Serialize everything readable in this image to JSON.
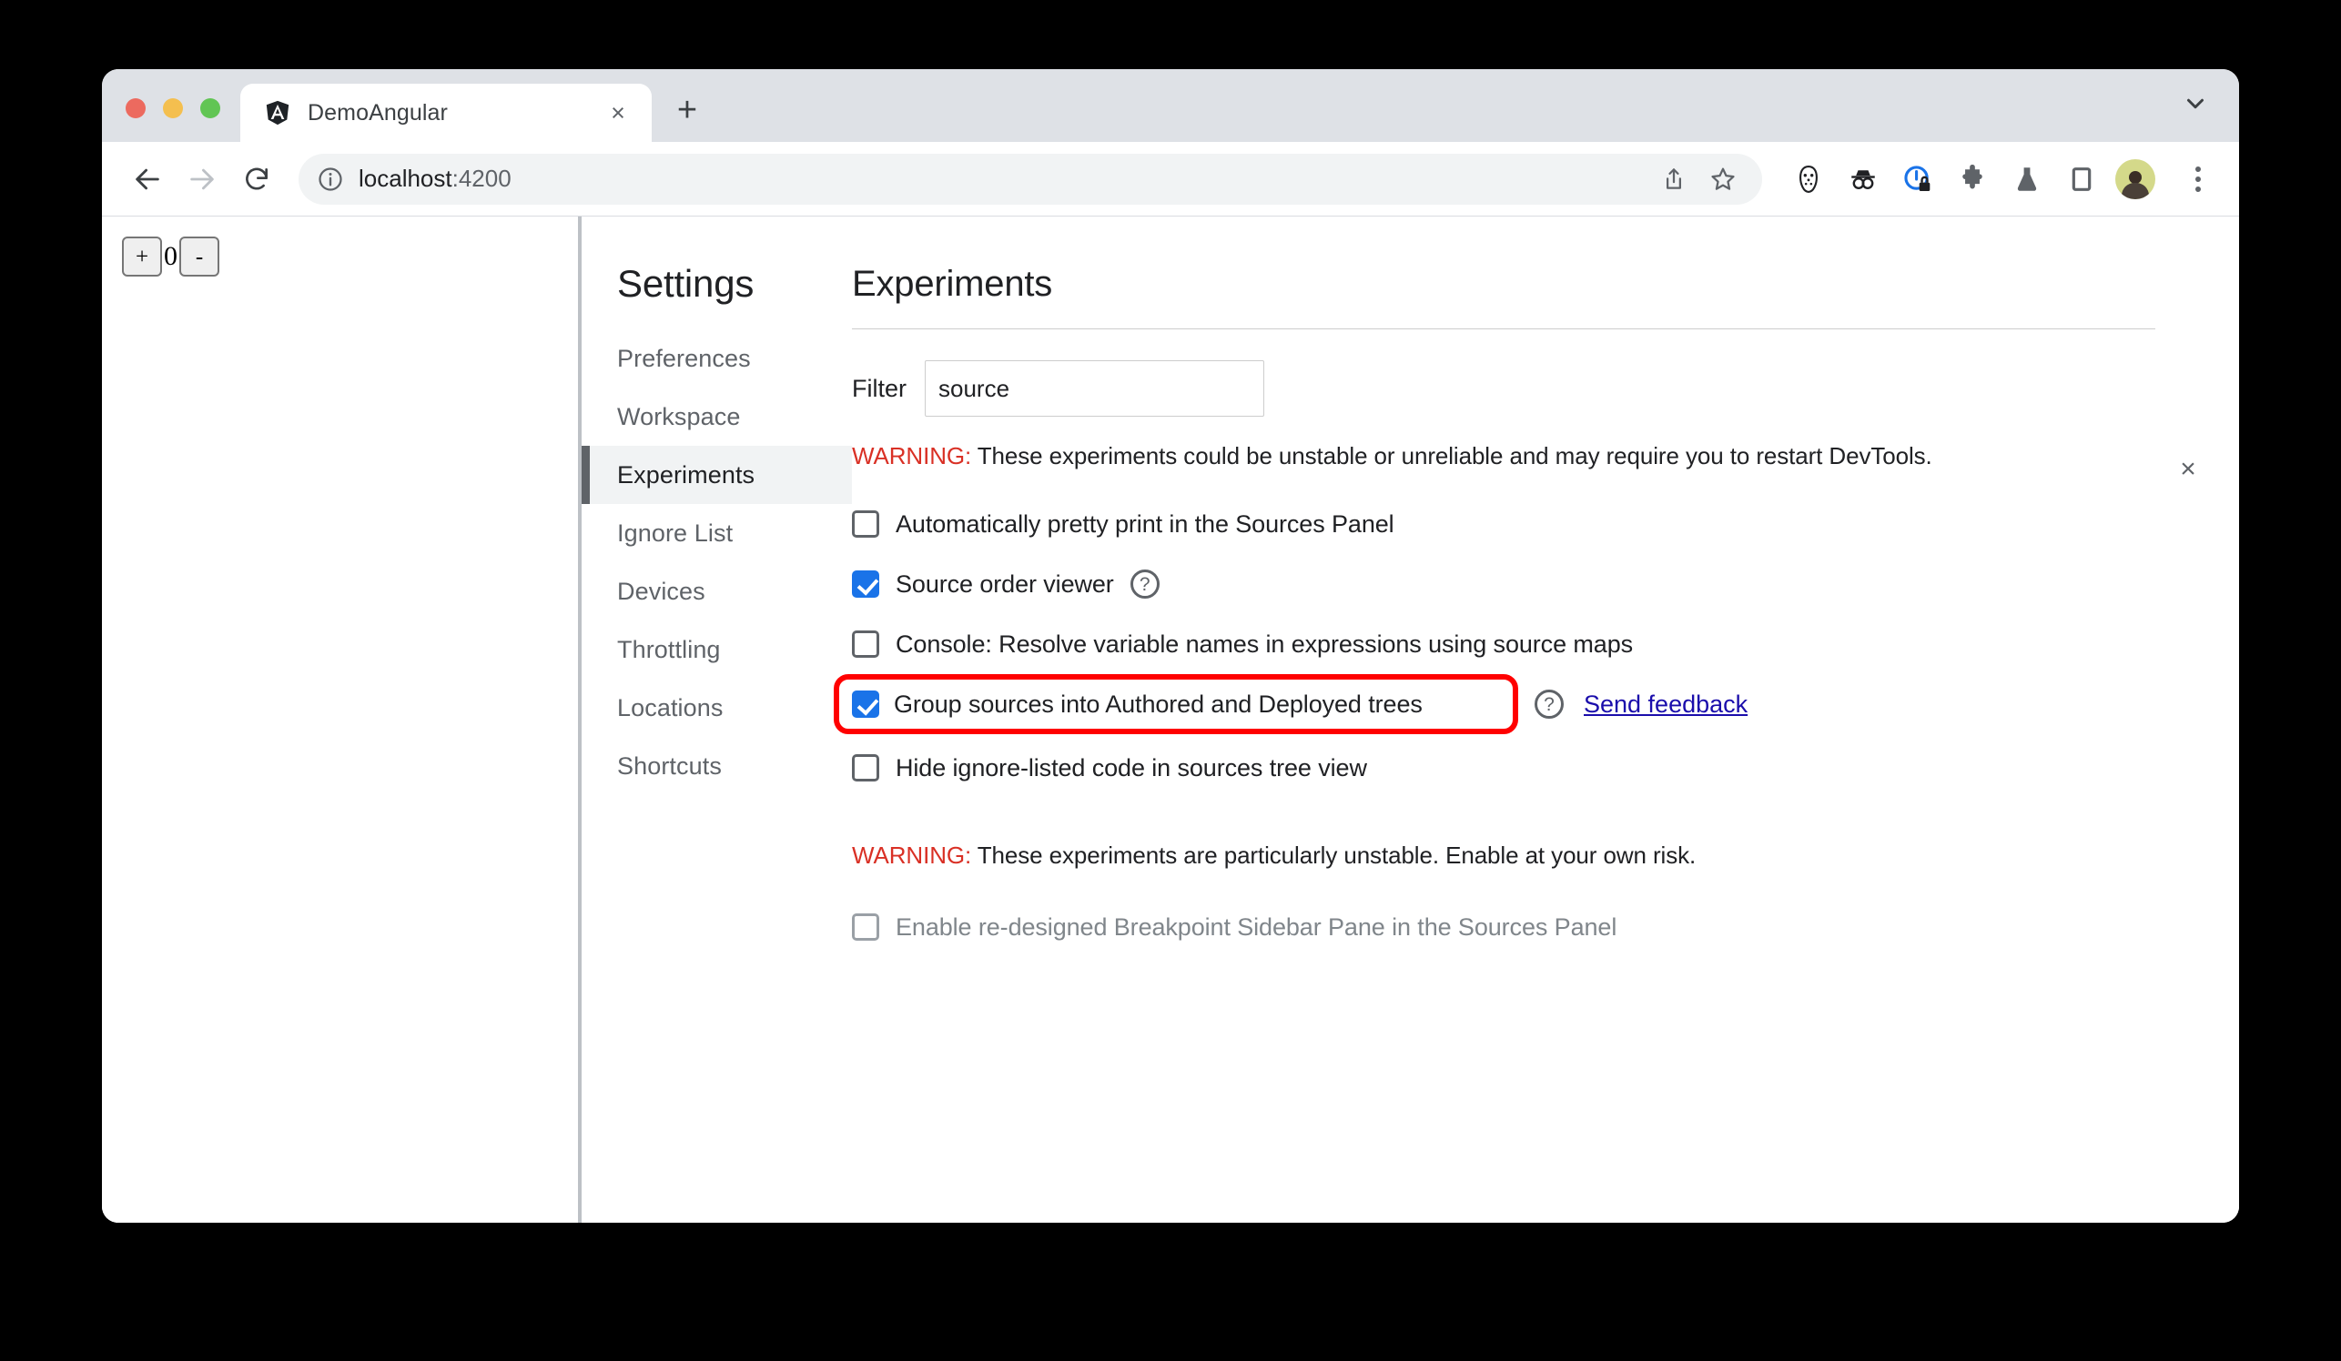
{
  "browser": {
    "tab": {
      "title": "DemoAngular",
      "favicon": "angular-logo-icon",
      "close_label": "×"
    },
    "new_tab_label": "+",
    "tab_search_icon": "chevron-down-icon",
    "nav": {
      "back_icon": "back-arrow-icon",
      "forward_icon": "forward-arrow-icon",
      "reload_icon": "reload-icon"
    },
    "omnibox": {
      "site_info_icon": "info-circle-icon",
      "url_host": "localhost",
      "url_port": ":4200",
      "url_full": "localhost:4200",
      "share_icon": "share-icon",
      "bookmark_icon": "star-icon"
    },
    "extensions": [
      {
        "name": "hockey-mask-icon"
      },
      {
        "name": "incognito-goggles-icon"
      },
      {
        "name": "privacy-lock-icon"
      },
      {
        "name": "puzzle-piece-icon"
      },
      {
        "name": "flask-icon"
      },
      {
        "name": "side-panel-icon"
      }
    ],
    "avatar_name": "profile-avatar",
    "menu_icon": "three-dot-menu-icon"
  },
  "page": {
    "counter": {
      "increment_label": "+",
      "value": "0",
      "decrement_label": "-"
    }
  },
  "devtools": {
    "close_label": "×",
    "settings": {
      "title": "Settings",
      "nav_items": [
        {
          "label": "Preferences",
          "active": false
        },
        {
          "label": "Workspace",
          "active": false
        },
        {
          "label": "Experiments",
          "active": true
        },
        {
          "label": "Ignore List",
          "active": false
        },
        {
          "label": "Devices",
          "active": false
        },
        {
          "label": "Throttling",
          "active": false
        },
        {
          "label": "Locations",
          "active": false
        },
        {
          "label": "Shortcuts",
          "active": false
        }
      ]
    },
    "panel": {
      "title": "Experiments",
      "filter": {
        "label": "Filter",
        "value": "source",
        "placeholder": "Filter"
      },
      "warning_1": {
        "keyword": "WARNING:",
        "text": " These experiments could be unstable or unreliable and may require you to restart DevTools."
      },
      "warning_2": {
        "keyword": "WARNING:",
        "text": " These experiments are particularly unstable. Enable at your own risk."
      },
      "experiments": [
        {
          "label": "Automatically pretty print in the Sources Panel",
          "checked": false,
          "disabled": false,
          "help": false,
          "feedback": null,
          "highlighted": false
        },
        {
          "label": "Source order viewer",
          "checked": true,
          "disabled": false,
          "help": true,
          "feedback": null,
          "highlighted": false
        },
        {
          "label": "Console: Resolve variable names in expressions using source maps",
          "checked": false,
          "disabled": false,
          "help": false,
          "feedback": null,
          "highlighted": false
        },
        {
          "label": "Group sources into Authored and Deployed trees",
          "checked": true,
          "disabled": false,
          "help": true,
          "feedback": "Send feedback",
          "highlighted": true
        },
        {
          "label": "Hide ignore-listed code in sources tree view",
          "checked": false,
          "disabled": false,
          "help": false,
          "feedback": null,
          "highlighted": false
        }
      ],
      "unstable_experiments": [
        {
          "label": "Enable re-designed Breakpoint Sidebar Pane in the Sources Panel",
          "checked": false,
          "disabled": true,
          "help": false,
          "feedback": null,
          "highlighted": false
        }
      ],
      "help_glyph": "?",
      "highlight_color": "#ff0000",
      "accent_color": "#1a73e8",
      "warning_color": "#d93025",
      "link_color": "#1a0dab"
    }
  }
}
